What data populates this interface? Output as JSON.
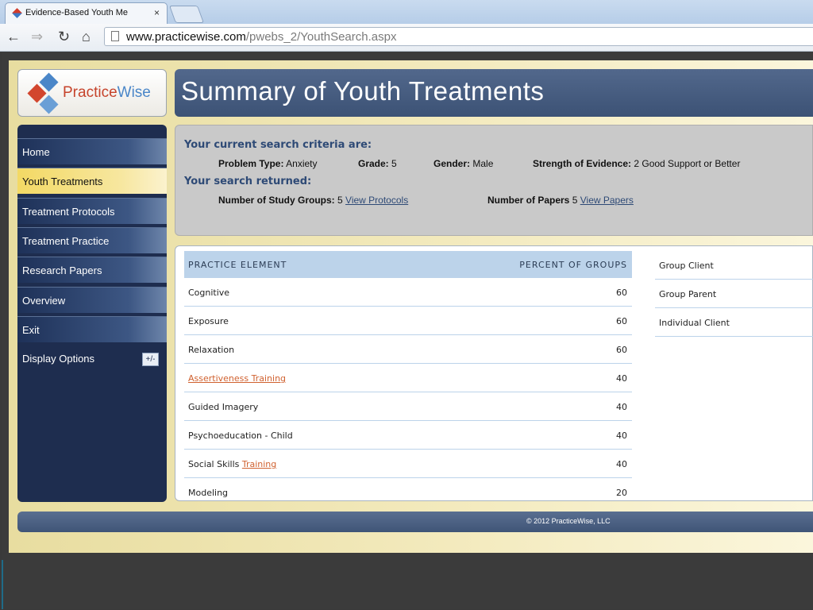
{
  "browser": {
    "tab_title": "Evidence-Based Youth Me",
    "tab_close": "×",
    "url_host": "www.practicewise.com",
    "url_path": "/pwebs_2/YouthSearch.aspx"
  },
  "brand": {
    "name_part1": "Practice",
    "name_part2": "Wise"
  },
  "header": {
    "title": "Summary of Youth Treatments"
  },
  "sidebar": {
    "items": [
      {
        "label": "Home"
      },
      {
        "label": "Youth Treatments"
      },
      {
        "label": "Treatment Protocols"
      },
      {
        "label": "Treatment Practice"
      },
      {
        "label": "Research Papers"
      },
      {
        "label": "Overview"
      },
      {
        "label": "Exit"
      },
      {
        "label": "Display Options",
        "toggle": "+/-"
      }
    ]
  },
  "criteria": {
    "heading": "Your current search criteria are:",
    "problem_type_label": "Problem Type:",
    "problem_type_value": "Anxiety",
    "grade_label": "Grade:",
    "grade_value": "5",
    "gender_label": "Gender:",
    "gender_value": "Male",
    "strength_label": "Strength of Evidence:",
    "strength_value": "2 Good Support or Better",
    "returned_heading": "Your search returned:",
    "study_groups_label": "Number of Study Groups:",
    "study_groups_value": "5",
    "view_protocols": "View Protocols",
    "papers_label": "Number of Papers",
    "papers_value": "5",
    "view_papers": "View Papers"
  },
  "table": {
    "col1": "PRACTICE ELEMENT",
    "col2": "PERCENT OF GROUPS",
    "rows": [
      {
        "element": "Cognitive",
        "percent": "60"
      },
      {
        "element": "Exposure",
        "percent": "60"
      },
      {
        "element": "Relaxation",
        "percent": "60"
      },
      {
        "element": "Assertiveness Training",
        "percent": "40"
      },
      {
        "element": "Guided Imagery",
        "percent": "40"
      },
      {
        "element": "Psychoeducation - Child",
        "percent": "40"
      },
      {
        "element_prefix": "Social Skills ",
        "element_link": "Training",
        "percent": "40"
      },
      {
        "element": "Modeling",
        "percent": "20"
      }
    ]
  },
  "formats": [
    "Group Client",
    "Group Parent",
    "Individual Client"
  ],
  "footer": {
    "copyright": "© 2012 PracticeWise, LLC"
  }
}
